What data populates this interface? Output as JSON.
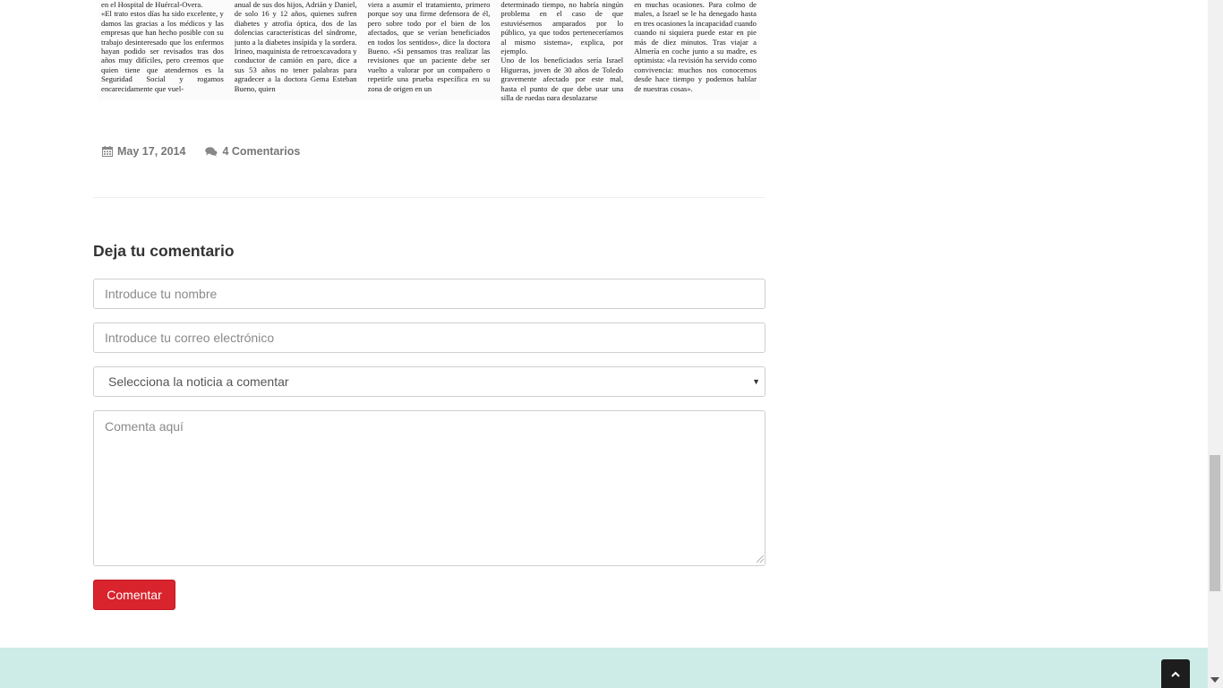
{
  "article": {
    "clipping_columns": [
      "en el Hospital de Huércal-Overa.\n«El trato estos días ha sido excelente, y damos las gracias a los médicos y las empresas que han hecho posible con su trabajo desinteresado que los enfermos hayan podido ser revisados tras dos años muy difíciles, pero creemos que quien tiene que atendernos es la Seguridad Social y rogamos encarecidamente que vuel-",
      "anual de sus dos hijos, Adrián y Daniel, de solo 16 y 12 años, quienes sufren diabetes y atrofia óptica, dos de las dolencias características del síndrome, junto a la diabetes insípida y la sordera. Irineo, maquinista de retroexcavadora y conductor de camión en paro, dice a sus 53 años no tener palabras para agradecer a la doctora Gema Esteban Bueno, quien",
      "viera a asumir el tratamiento, primero porque soy una firme defensora de él, pero sobre todo por el bien de los afectados, que se verían beneficiados en todos los sentidos», dice la doctora Bueno. «Si pensamos tras realizar las revisiones que un paciente debe ser vuelto a valorar por un compañero o repetirle una prueba específica en su zona de origen en un",
      "determinado tiempo, no habría ningún problema en el caso de que estuviésemos amparados por lo público, ya que todos perteneceríamos al mismo sistema», explica, por ejemplo.\nUno de los beneficiados sería Israel Higueras, joven de 30 años de Toledo gravemente afectado por este mal, hasta el punto de que debe usar una silla de ruedas para desplazarse",
      "en muchas ocasiones. Para colmo de males, a Israel se le ha denegado hasta en tres ocasiones la incapacidad cuando cuando ni siquiera puede estar en pie más de diez minutos. Tras viajar a Almería en coche junto a su madre, es optimista: «la revisión ha servido como convivencia: muchos nos conocemos desde hace tiempo y podemos hablar de nuestras cosas»."
    ],
    "date": "May 17, 2014",
    "comments_link": "4 Comentarios"
  },
  "comment_form": {
    "title": "Deja tu comentario",
    "name_placeholder": "Introduce tu nombre",
    "email_placeholder": "Introduce tu correo electrónico",
    "select_value": "Selecciona la noticia a comentar",
    "comment_placeholder": "Comenta aquí",
    "submit_label": "Comentar"
  },
  "colors": {
    "submit_button": "#d9232d",
    "footer_band": "#cdece7",
    "back_to_top": "#1d1d1d"
  },
  "icons": {
    "date": "calendar-icon",
    "comments": "comments-icon",
    "back_to_top": "chevron-up-icon",
    "select": "caret-down-icon"
  }
}
